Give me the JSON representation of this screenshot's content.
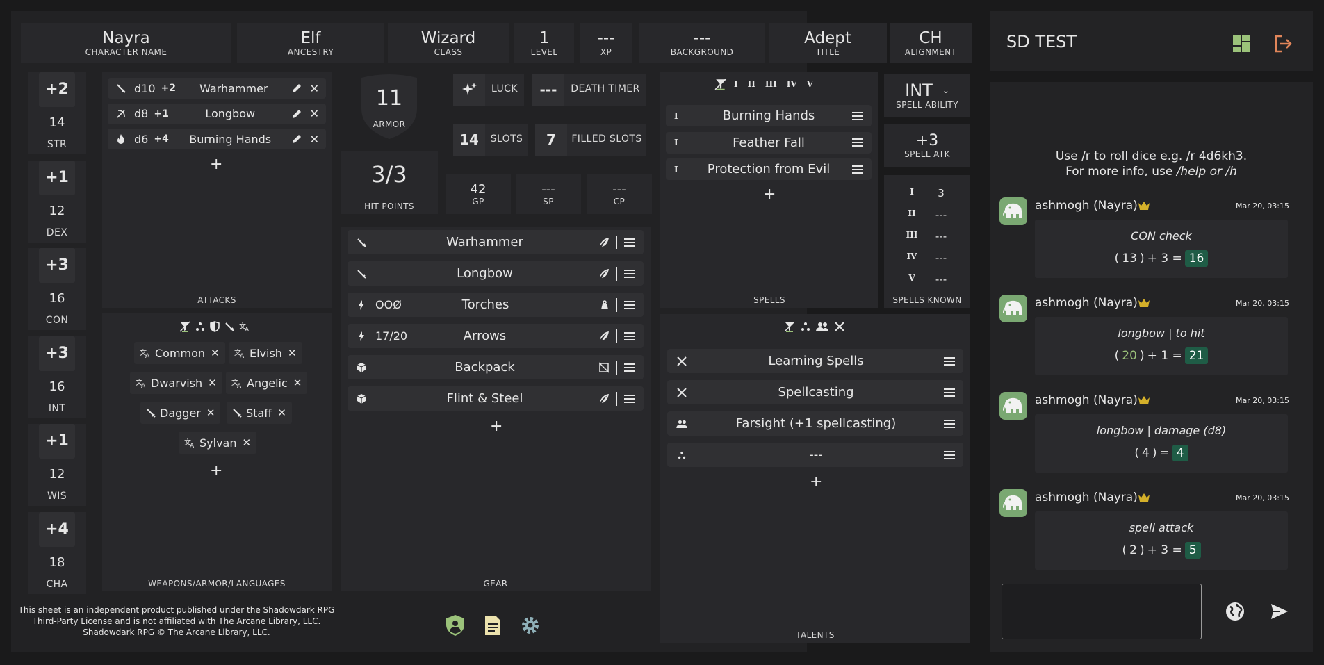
{
  "header": [
    {
      "value": "Nayra",
      "label": "CHARACTER NAME"
    },
    {
      "value": "Elf",
      "label": "ANCESTRY"
    },
    {
      "value": "Wizard",
      "label": "CLASS"
    },
    {
      "value": "1",
      "label": "LEVEL"
    },
    {
      "value": "---",
      "label": "XP"
    },
    {
      "value": "---",
      "label": "BACKGROUND"
    },
    {
      "value": "Adept",
      "label": "TITLE"
    },
    {
      "value": "CH",
      "label": "ALIGNMENT"
    }
  ],
  "stats": [
    {
      "mod": "+2",
      "score": "14",
      "name": "STR"
    },
    {
      "mod": "+1",
      "score": "12",
      "name": "DEX"
    },
    {
      "mod": "+3",
      "score": "16",
      "name": "CON"
    },
    {
      "mod": "+3",
      "score": "16",
      "name": "INT"
    },
    {
      "mod": "+1",
      "score": "12",
      "name": "WIS"
    },
    {
      "mod": "+4",
      "score": "18",
      "name": "CHA"
    }
  ],
  "attacks": {
    "title": "ATTACKS",
    "items": [
      {
        "icon": "sword-icon",
        "die": "d10",
        "bonus": "+2",
        "name": "Warhammer"
      },
      {
        "icon": "bow-icon",
        "die": "d8",
        "bonus": "+1",
        "name": "Longbow"
      },
      {
        "icon": "flame-icon",
        "die": "d6",
        "bonus": "+4",
        "name": "Burning Hands"
      }
    ]
  },
  "weapons": {
    "title": "WEAPONS/ARMOR/LANGUAGES",
    "chips": [
      {
        "icon": "translate-icon",
        "label": "Common"
      },
      {
        "icon": "translate-icon",
        "label": "Elvish"
      },
      {
        "icon": "translate-icon",
        "label": "Dwarvish"
      },
      {
        "icon": "translate-icon",
        "label": "Angelic"
      },
      {
        "icon": "sword-icon",
        "label": "Dagger"
      },
      {
        "icon": "sword-icon",
        "label": "Staff"
      },
      {
        "icon": "translate-icon",
        "label": "Sylvan"
      }
    ]
  },
  "armor": {
    "value": "11",
    "label": "ARMOR"
  },
  "hp": {
    "value": "3/3",
    "label": "HIT POINTS"
  },
  "luck": {
    "label": "LUCK"
  },
  "death_timer": {
    "value": "---",
    "label": "DEATH TIMER"
  },
  "slots": {
    "value": "14",
    "label": "SLOTS"
  },
  "filled_slots": {
    "value": "7",
    "label": "FILLED SLOTS"
  },
  "coins": [
    {
      "value": "42",
      "label": "GP"
    },
    {
      "value": "---",
      "label": "SP"
    },
    {
      "value": "---",
      "label": "CP"
    }
  ],
  "gear": {
    "title": "GEAR",
    "items": [
      {
        "icon": "sword-icon",
        "qty": "",
        "name": "Warhammer",
        "status": "feather-icon"
      },
      {
        "icon": "sword-icon",
        "qty": "",
        "name": "Longbow",
        "status": "feather-icon"
      },
      {
        "icon": "bolt-icon",
        "qty": "OOØ",
        "name": "Torches",
        "status": "weight-icon"
      },
      {
        "icon": "bolt-icon",
        "qty": "17/20",
        "name": "Arrows",
        "status": "feather-icon"
      },
      {
        "icon": "cube-icon",
        "qty": "",
        "name": "Backpack",
        "status": "no-slot-icon"
      },
      {
        "icon": "cube-icon",
        "qty": "",
        "name": "Flint & Steel",
        "status": "feather-icon"
      }
    ]
  },
  "spells": {
    "title": "SPELLS",
    "tiers": [
      "I",
      "II",
      "III",
      "IV",
      "V"
    ],
    "items": [
      {
        "tier": "I",
        "name": "Burning Hands"
      },
      {
        "tier": "I",
        "name": "Feather Fall"
      },
      {
        "tier": "I",
        "name": "Protection from Evil"
      }
    ]
  },
  "spell_ability": {
    "value": "INT",
    "label": "SPELL ABILITY"
  },
  "spell_atk": {
    "value": "+3",
    "label": "SPELL ATK"
  },
  "spells_known": {
    "title": "SPELLS KNOWN",
    "rows": [
      {
        "tier": "I",
        "value": "3"
      },
      {
        "tier": "II",
        "value": "---"
      },
      {
        "tier": "III",
        "value": "---"
      },
      {
        "tier": "IV",
        "value": "---"
      },
      {
        "tier": "V",
        "value": "---"
      }
    ]
  },
  "talents": {
    "title": "TALENTS",
    "items": [
      {
        "icon": "swords-icon",
        "name": "Learning Spells"
      },
      {
        "icon": "swords-icon",
        "name": "Spellcasting"
      },
      {
        "icon": "users-icon",
        "name": "Farsight (+1 spellcasting)"
      },
      {
        "icon": "dots-icon",
        "name": "---"
      }
    ]
  },
  "footer": {
    "license": [
      "This sheet is an independent product published under the Shadowdark RPG",
      "Third-Party License and is not affiliated with The Arcane Library, LLC.",
      "Shadowdark RPG © The Arcane Library, LLC."
    ]
  },
  "chat": {
    "title": "SD TEST",
    "help": [
      "Use /r to roll dice e.g. /r 4d6kh3.",
      "For more info, use "
    ],
    "help_italic": "/help or /h",
    "messages": [
      {
        "user": "ashmogh (Nayra)",
        "time": "Mar 20, 03:15",
        "label": "CON check",
        "roll": "13",
        "formula_rest": " + 3 =",
        "result": "16"
      },
      {
        "user": "ashmogh (Nayra)",
        "time": "Mar 20, 03:15",
        "label": "longbow | to hit",
        "roll": "20",
        "formula_rest": " + 1 =",
        "result": "21"
      },
      {
        "user": "ashmogh (Nayra)",
        "time": "Mar 20, 03:15",
        "label": "longbow | damage (d8)",
        "roll": "4",
        "formula_rest": " =",
        "result": "4"
      },
      {
        "user": "ashmogh (Nayra)",
        "time": "Mar 20, 03:15",
        "label": "spell attack",
        "roll": "2",
        "formula_rest": " + 3 =",
        "result": "5"
      }
    ]
  },
  "colors": {
    "accent_green": "#9bc27a",
    "result_bg": "#1f5c46",
    "crown": "#d4b02a",
    "logout": "#e0855a",
    "panel": "#222224",
    "page": "#1a1a1b"
  }
}
